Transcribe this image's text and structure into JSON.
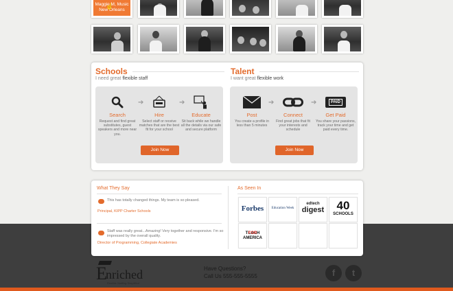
{
  "photo_grid": {
    "active_tile_text": [
      "Maggie M, Music",
      "New Orleans"
    ]
  },
  "schools": {
    "title": "Schools",
    "subtitle_prefix": "I need great ",
    "subtitle_em": "flexible staff",
    "steps": [
      {
        "label": "Search",
        "desc": "Request and find great substitutes, guest speakers and more near you.",
        "icon": "magnifier-icon"
      },
      {
        "label": "Hire",
        "desc": "Select staff or receive matches that are the best fit for your school",
        "icon": "sign-icon"
      },
      {
        "label": "Educate",
        "desc": "Sit back while we handle all the details via our safe and secure platform",
        "icon": "teacher-board-icon"
      }
    ],
    "join_label": "Join Now"
  },
  "talent": {
    "title": "Talent",
    "subtitle_prefix": "I want great ",
    "subtitle_em": "flexible work",
    "steps": [
      {
        "label": "Post",
        "desc": "You create a profile in less than 5 minutes",
        "icon": "envelope-icon"
      },
      {
        "label": "Connect",
        "desc": "Find great jobs that fit your interests and schedule",
        "icon": "chain-link-icon"
      },
      {
        "label": "Get Paid",
        "desc": "You share your passions, track your time and get paid every time.",
        "icon": "paid-ticket-icon"
      }
    ],
    "paid_badge": "PAID",
    "join_label": "Join Now"
  },
  "testimonials": {
    "title": "What They Say",
    "items": [
      {
        "quote": "This has totally changed things. My team is so pleased.",
        "author": "Principal, KIPP Charter Schools"
      },
      {
        "quote": "Staff was really great...Amazing! Very together and responsive. I'm so impressed by the overall quality.",
        "author": "Director of Programming, Collegiate Academies"
      }
    ]
  },
  "press": {
    "title": "As Seen In",
    "logos": [
      {
        "name": "Forbes"
      },
      {
        "name": "Education Week"
      },
      {
        "name": "edtech digest",
        "top": "edtech",
        "bottom": "digest"
      },
      {
        "name": "40 Schools",
        "top": "40",
        "bottom": "SCHOOLS"
      },
      {
        "name": "Teach For America",
        "top_a": "TEACH",
        "top_b": "FOR",
        "bottom": "AMERICA"
      }
    ]
  },
  "footer": {
    "brand": "nriched",
    "brand_letter": "E",
    "tagline": "Flexible Staffing Simplified",
    "question_line1": "Have Questions?",
    "question_line2": "Call Us 555-555-5555",
    "facebook_glyph": "f",
    "twitter_glyph": "t"
  },
  "colors": {
    "accent": "#e36b2c",
    "button": "#e0652a",
    "footer_bg": "#3e3e3e"
  }
}
